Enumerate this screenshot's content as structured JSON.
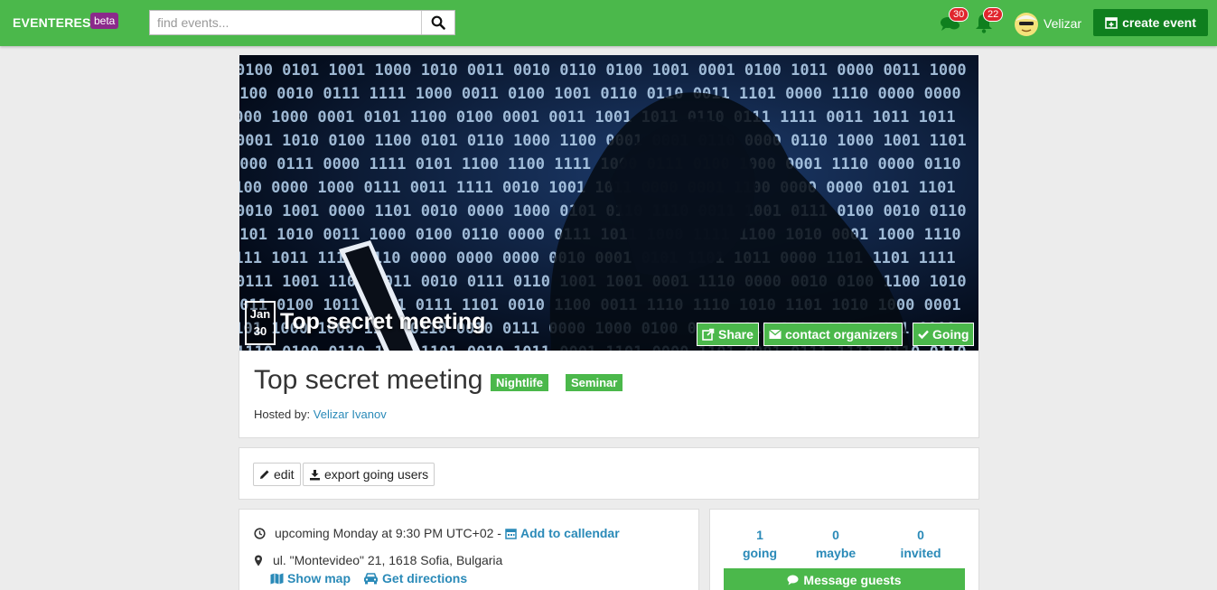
{
  "brand": {
    "name": "EVENTERES",
    "badge": "beta"
  },
  "search": {
    "placeholder": "find events...",
    "value": ""
  },
  "nav": {
    "messages_count": "30",
    "notifications_count": "22",
    "user_name": "Velizar",
    "create_label": "create event"
  },
  "event": {
    "date_month": "Jan",
    "date_day": "30",
    "title": "Top secret meeting",
    "tags": [
      "Nightlife",
      "Seminar"
    ],
    "hosted_label": "Hosted by:",
    "host_name": "Velizar Ivanov",
    "cover_buttons": {
      "share": "Share",
      "contact": "contact organizers",
      "going": "Going"
    }
  },
  "actions": {
    "edit": "edit",
    "export": "export going users"
  },
  "details": {
    "time_text": "upcoming Monday at 9:30 PM UTC+02 -",
    "add_calendar": "Add to callendar",
    "address": "ul. \"Montevideo\" 21, 1618 Sofia, Bulgaria",
    "show_map": "Show map",
    "get_directions": "Get directions"
  },
  "stats": {
    "going_count": "1",
    "going_label": "going",
    "maybe_count": "0",
    "maybe_label": "maybe",
    "invited_count": "0",
    "invited_label": "invited",
    "message_label": "Message guests"
  },
  "colors": {
    "accent": "#4bb84b",
    "accent_dark": "#0f7f1e",
    "link": "#2a8ab8",
    "badge": "#e0262d",
    "beta": "#8b2a8b"
  }
}
